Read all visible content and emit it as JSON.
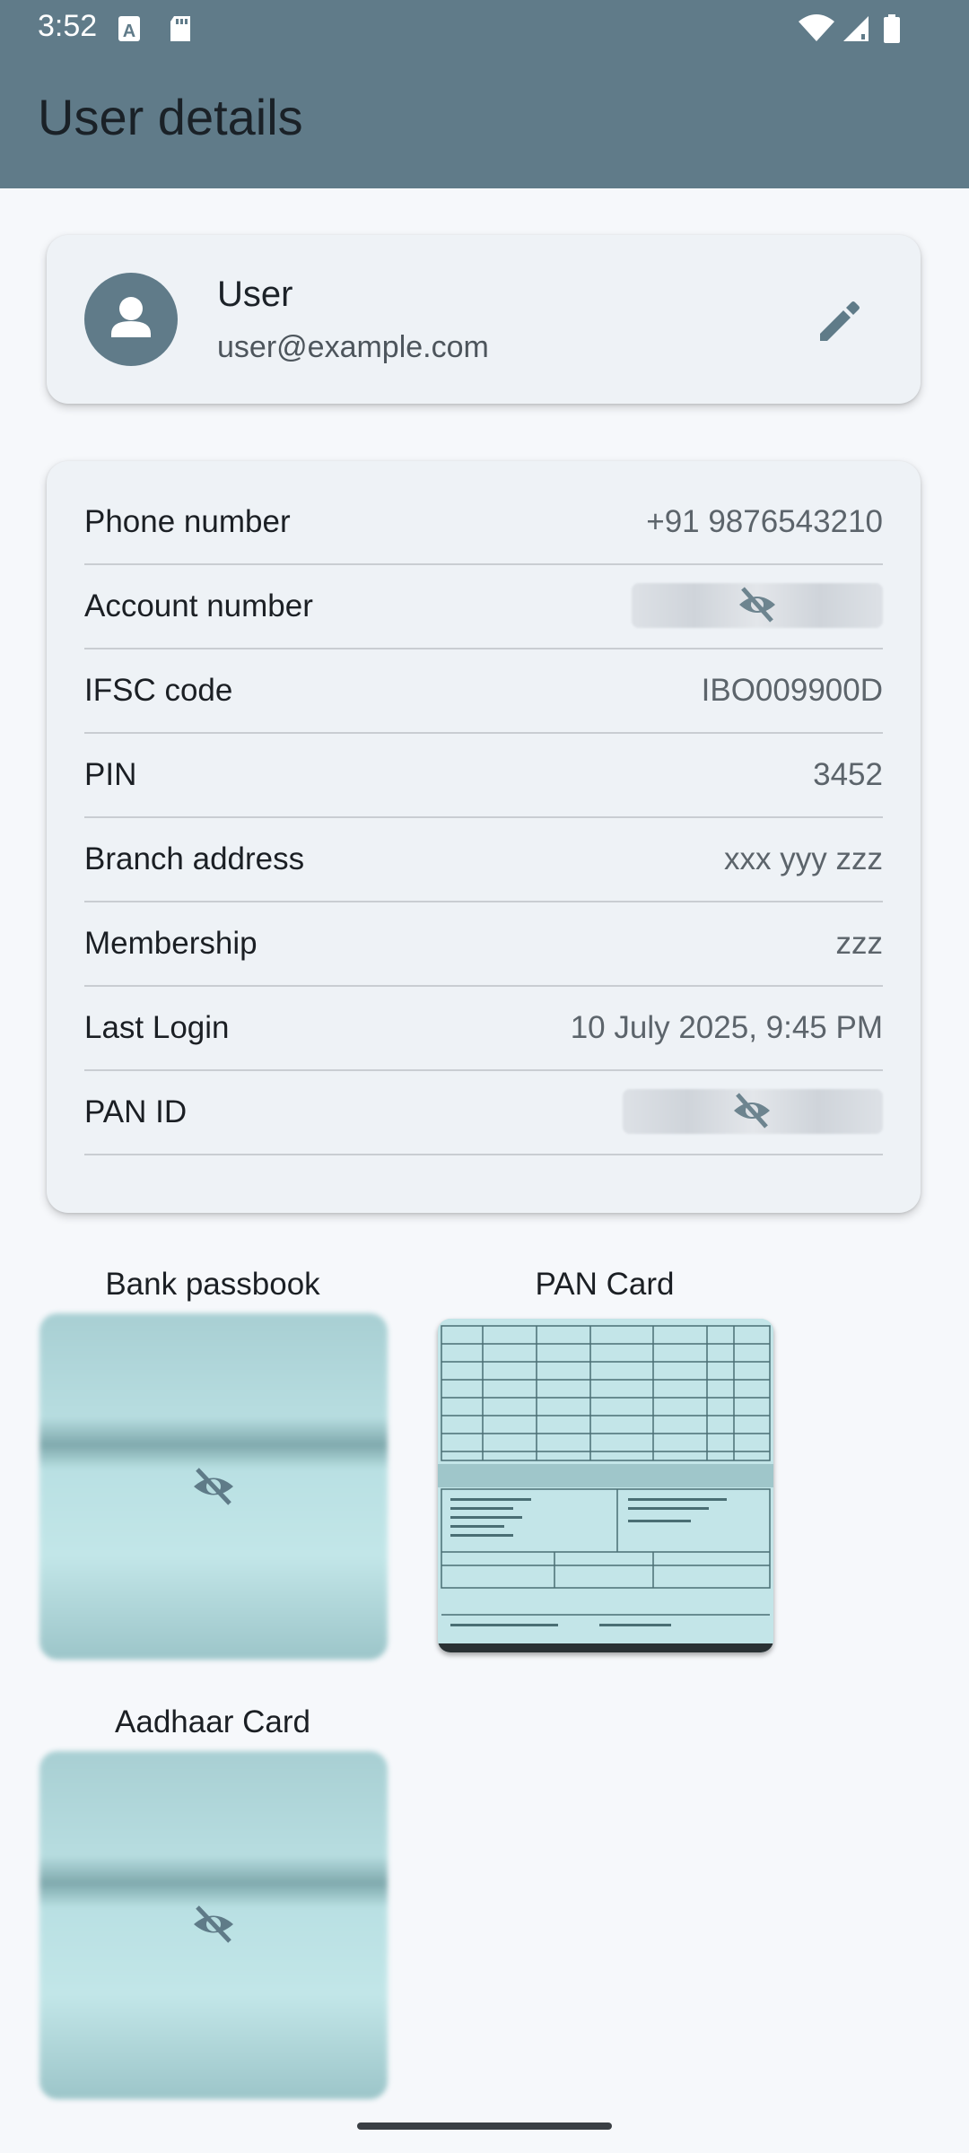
{
  "status_bar": {
    "time": "3:52",
    "icons": [
      "text-a-icon",
      "sd-card-icon",
      "wifi-icon",
      "signal-icon",
      "battery-icon"
    ]
  },
  "app_bar": {
    "title": "User details"
  },
  "profile": {
    "name": "User",
    "email": "user@example.com",
    "avatar_icon": "person-icon",
    "edit_icon": "edit-pencil-icon"
  },
  "details": [
    {
      "label": "Phone number",
      "value": "+91 9876543210",
      "masked": false
    },
    {
      "label": "Account number",
      "value": "",
      "masked": true
    },
    {
      "label": "IFSC code",
      "value": "IBO009900D",
      "masked": false
    },
    {
      "label": "PIN",
      "value": "3452",
      "masked": false
    },
    {
      "label": "Branch address",
      "value": "xxx yyy zzz",
      "masked": false
    },
    {
      "label": "Membership",
      "value": "zzz",
      "masked": false
    },
    {
      "label": "Last Login",
      "value": "10 July 2025, 9:45 PM",
      "masked": false
    },
    {
      "label": "PAN ID",
      "value": "",
      "masked": true
    }
  ],
  "documents": [
    {
      "label": "Bank passbook",
      "hidden": true
    },
    {
      "label": "PAN Card",
      "hidden": false
    },
    {
      "label": "Aadhaar Card",
      "hidden": true
    }
  ],
  "colors": {
    "app_bar": "#607b89",
    "background": "#f6f8fb",
    "card": "#eef2f6",
    "icon": "#5f7b88"
  }
}
